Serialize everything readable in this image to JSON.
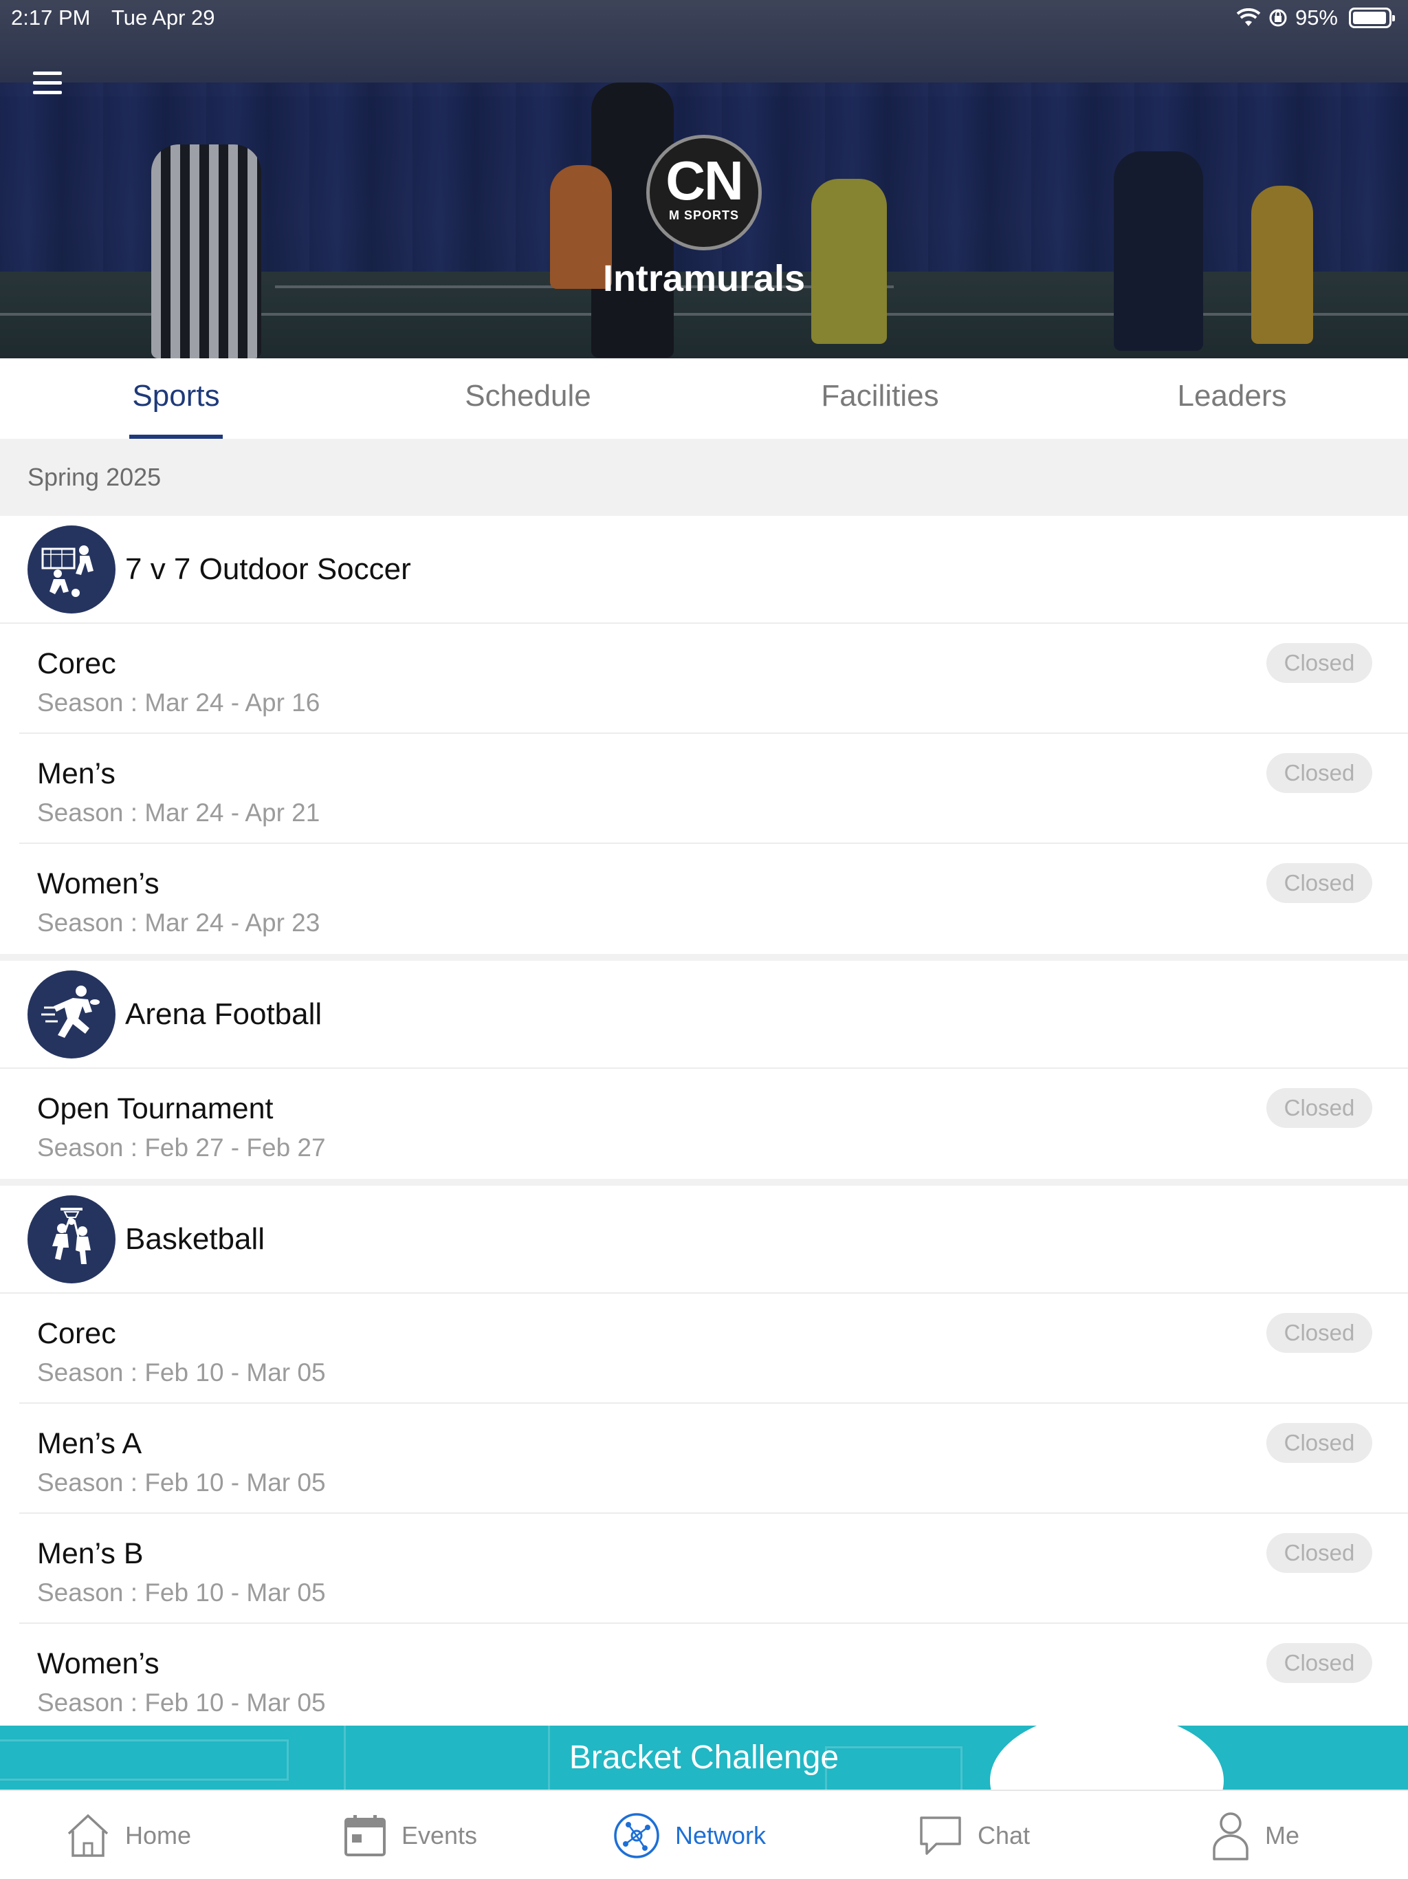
{
  "status": {
    "time": "2:17 PM",
    "date": "Tue Apr 29",
    "battery": "95%"
  },
  "header": {
    "logo_main": "CN",
    "logo_sub": "M SPORTS",
    "title": "Intramurals"
  },
  "tabs": [
    {
      "label": "Sports",
      "active": true
    },
    {
      "label": "Schedule",
      "active": false
    },
    {
      "label": "Facilities",
      "active": false
    },
    {
      "label": "Leaders",
      "active": false
    }
  ],
  "term": "Spring 2025",
  "sports": [
    {
      "name": "7 v 7 Outdoor Soccer",
      "icon": "soccer-icon",
      "leagues": [
        {
          "name": "Corec",
          "season": "Season : Mar 24 - Apr 16",
          "status": "Closed"
        },
        {
          "name": "Men’s",
          "season": "Season : Mar 24 - Apr 21",
          "status": "Closed"
        },
        {
          "name": "Women’s",
          "season": "Season : Mar 24 - Apr 23",
          "status": "Closed"
        }
      ]
    },
    {
      "name": "Arena Football",
      "icon": "football-icon",
      "leagues": [
        {
          "name": "Open Tournament",
          "season": "Season : Feb 27 - Feb 27",
          "status": "Closed"
        }
      ]
    },
    {
      "name": "Basketball",
      "icon": "basketball-icon",
      "leagues": [
        {
          "name": "Corec",
          "season": "Season : Feb 10 - Mar 05",
          "status": "Closed"
        },
        {
          "name": "Men’s A",
          "season": "Season : Feb 10 - Mar 05",
          "status": "Closed"
        },
        {
          "name": "Men’s B",
          "season": "Season : Feb 10 - Mar 05",
          "status": "Closed"
        },
        {
          "name": "Women’s",
          "season": "Season : Feb 10 - Mar 05",
          "status": "Closed"
        }
      ]
    }
  ],
  "banner": {
    "label": "Bracket Challenge"
  },
  "bottom_nav": [
    {
      "label": "Home",
      "icon": "home-icon",
      "active": false
    },
    {
      "label": "Events",
      "icon": "calendar-icon",
      "active": false
    },
    {
      "label": "Network",
      "icon": "network-icon",
      "active": true
    },
    {
      "label": "Chat",
      "icon": "chat-icon",
      "active": false
    },
    {
      "label": "Me",
      "icon": "person-icon",
      "active": false
    }
  ],
  "colors": {
    "accent": "#1f3a7a",
    "sport_icon_bg": "#25345f",
    "banner": "#21b7c4",
    "nav_active": "#1d6fd6"
  }
}
